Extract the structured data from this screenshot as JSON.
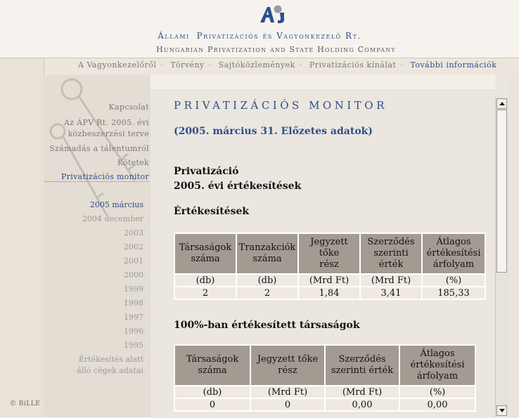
{
  "header": {
    "title_hu_1": "Állami",
    "title_hu_2": "Privatizációs és Vagyonkezelő Rt.",
    "title_en": "Hungarian Privatization and State Holding Company"
  },
  "topnav": {
    "items": [
      "A Vagyonkezelőről",
      "Törvény",
      "Sajtóközlemények",
      "Privatizációs kínálat",
      "További információk"
    ]
  },
  "sidebar": {
    "items": [
      "Kapcsolat",
      "Az ÁPV Rt. 2005. évi",
      "közbeszerzési terve",
      "Számadás a tálentumról",
      "Kötetek",
      "Privatizációs monitor"
    ],
    "years": [
      "2005 március",
      "2004 december",
      "2003",
      "2002",
      "2001",
      "2000",
      "1999",
      "1998",
      "1997",
      "1996",
      "1995"
    ],
    "extra_1": "Értékesítés alatt",
    "extra_2": "álló cégek adatai",
    "copyright": "© BiLLE"
  },
  "content": {
    "title": "PRIVATIZÁCIÓS MONITOR",
    "subtitle": "(2005. március 31. Előzetes adatok)",
    "heading1a": "Privatizáció",
    "heading1b": "2005. évi értékesítések",
    "section1": "Értékesítések",
    "section2": "100%-ban értékesített társaságok"
  },
  "table1": {
    "headers": [
      [
        "Társaságok",
        "száma"
      ],
      [
        "Tranzakciók",
        "száma"
      ],
      [
        "Jegyzett tőke",
        "rész"
      ],
      [
        "Szerződés",
        "szerinti érték"
      ],
      [
        "Átlagos",
        "értékesítési",
        "árfolyam"
      ]
    ],
    "units": [
      "(db)",
      "(db)",
      "(Mrd Ft)",
      "(Mrd Ft)",
      "(%)"
    ],
    "values": [
      "2",
      "2",
      "1,84",
      "3,41",
      "185,33"
    ]
  },
  "table2": {
    "headers": [
      [
        "Társaságok",
        "száma"
      ],
      [
        "Jegyzett tőke",
        "rész"
      ],
      [
        "Szerződés",
        "szerinti érték"
      ],
      [
        "Átlagos",
        "értékesítési",
        "árfolyam"
      ]
    ],
    "units": [
      "(db)",
      "(Mrd Ft)",
      "(Mrd Ft)",
      "(%)"
    ],
    "values": [
      "0",
      "0",
      "0,00",
      "0,00"
    ]
  },
  "colors": {
    "accent": "#2d4f8c",
    "table_header": "#a39a92",
    "table_cell": "#efe9e1"
  }
}
